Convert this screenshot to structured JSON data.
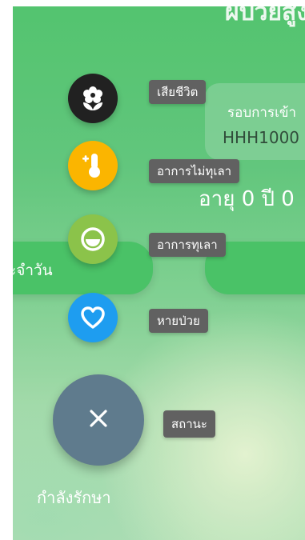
{
  "background": {
    "title": "ผ้ป่วยสูง",
    "card_label": "รอบการเข้า",
    "card_id": "HHH1000",
    "age_text": "อายุ 0 ปี 0",
    "left_pill_label": "ะจำวัน"
  },
  "speed_dial": {
    "actions": [
      {
        "label": "เสียชีวิต",
        "icon": "flower-icon",
        "color": "#212121"
      },
      {
        "label": "อาการไม่ทุเลา",
        "icon": "thermometer-plus-icon",
        "color": "#fbb500"
      },
      {
        "label": "อาการทุเลา",
        "icon": "half-circle-icon",
        "color": "#8bc34a"
      },
      {
        "label": "หายป่วย",
        "icon": "heart-outline-icon",
        "color": "#1e9df0"
      }
    ],
    "main": {
      "label": "สถานะ",
      "icon": "close-icon",
      "color": "#5f7b8d"
    },
    "current_status": "กำลังรักษา"
  }
}
